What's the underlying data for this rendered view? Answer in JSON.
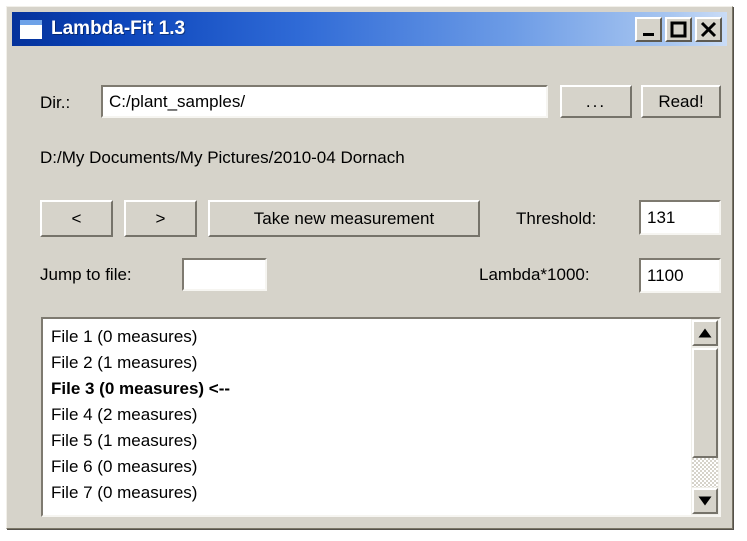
{
  "window": {
    "title": "Lambda-Fit 1.3",
    "app_icon": "window-document-icon",
    "caption_buttons": [
      {
        "name": "minimize-button",
        "icon": "minimize-icon",
        "label": "_"
      },
      {
        "name": "maximize-button",
        "icon": "maximize-icon",
        "label": "□"
      },
      {
        "name": "close-button",
        "icon": "close-icon",
        "label": "X"
      }
    ],
    "colors": {
      "titlebar_start": "#05329b",
      "titlebar_end": "#cadcf6",
      "face": "#d6d3ca",
      "field_bg": "#ffffff",
      "text": "#000000"
    }
  },
  "form": {
    "dir_label": "Dir.:",
    "dir_value": "C:/plant_samples/",
    "dir_placeholder": "",
    "browse_button": "...",
    "read_button": "Read!",
    "current_path": "D:/My Documents/My Pictures/2010-04 Dornach",
    "prev_button": "<",
    "next_button": ">",
    "take_measurement_button": "Take new measurement",
    "threshold_label": "Threshold:",
    "threshold_value": "131",
    "jump_to_file_label": "Jump to file:",
    "jump_to_file_value": "",
    "jump_to_file_placeholder": "",
    "lambda_label": "Lambda*1000:",
    "lambda_value": "1100"
  },
  "file_list": {
    "items": [
      {
        "label": "File 1 (0 measures)",
        "selected": false
      },
      {
        "label": "File 2 (1 measures)",
        "selected": false
      },
      {
        "label": "File 3 (0 measures) <--",
        "selected": true
      },
      {
        "label": "File 4 (2 measures)",
        "selected": false
      },
      {
        "label": "File 5 (1 measures)",
        "selected": false
      },
      {
        "label": "File 6 (0 measures)",
        "selected": false
      },
      {
        "label": "File 7 (0 measures)",
        "selected": false
      }
    ],
    "scrollbar": {
      "up_arrow": "scroll-up-icon",
      "down_arrow": "scroll-down-icon"
    }
  }
}
